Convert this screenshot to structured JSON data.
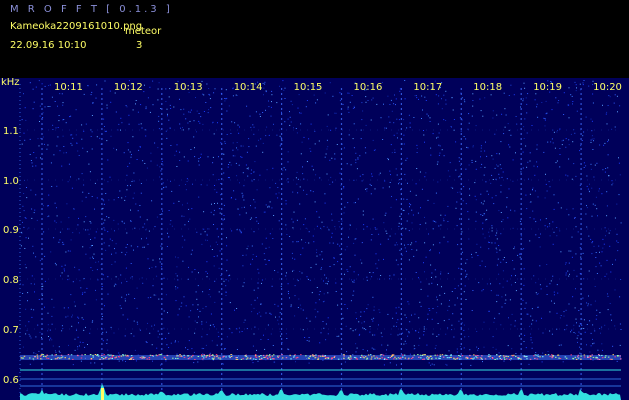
{
  "header": {
    "app_title": "M R O F F T  [ 0.1.3 ]",
    "filename": "Kameoka2209161010.png",
    "meteor_label": "meteor",
    "datetime": "22.09.16  10:10",
    "meteor_count": "3"
  },
  "axis": {
    "unit": "kHz",
    "y_ticks": [
      "1.1",
      "1.0",
      "0.9",
      "0.8",
      "0.7",
      "0.6"
    ],
    "x_ticks": [
      "10:11",
      "10:12",
      "10:13",
      "10:14",
      "10:15",
      "10:16",
      "10:17",
      "10:18",
      "10:19",
      "10:20"
    ]
  },
  "colors": {
    "background": "#00005a",
    "header_text": "#ffff66",
    "title_text": "#8a8fd8",
    "axis_text": "#ffff66",
    "grid": "#2a5bd8",
    "signal_line": "#f0a0c0",
    "baseline": "#33e0e0"
  }
}
